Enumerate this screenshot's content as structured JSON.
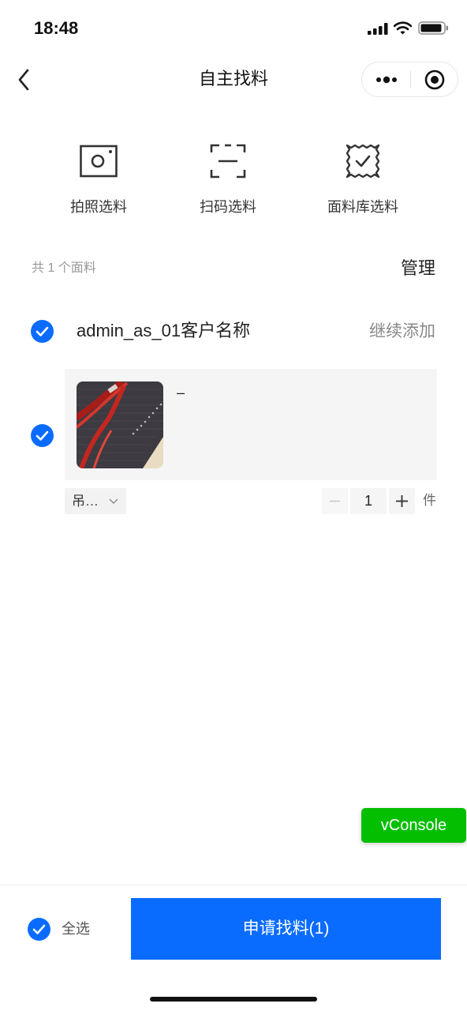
{
  "status_bar": {
    "time": "18:48",
    "icons": [
      "cellular-signal-icon",
      "wifi-icon",
      "battery-icon"
    ]
  },
  "nav": {
    "title": "自主找料",
    "back_icon": "chevron-left-icon",
    "more_icon": "more-dots-icon",
    "target_icon": "record-circle-icon"
  },
  "options": [
    {
      "label": "拍照选料",
      "icon": "camera-icon"
    },
    {
      "label": "扫码选料",
      "icon": "scan-icon"
    },
    {
      "label": "面料库选料",
      "icon": "fabric-library-icon"
    }
  ],
  "summary": {
    "count_text": "共 1 个面料",
    "manage_label": "管理"
  },
  "group": {
    "checked": true,
    "customer_name": "admin_as_01客户名称",
    "add_more_label": "继续添加"
  },
  "items": [
    {
      "checked": true,
      "name": "–",
      "spec_label": "吊…",
      "quantity": "1",
      "unit": "件"
    }
  ],
  "vconsole": {
    "label": "vConsole"
  },
  "footer": {
    "select_all_checked": true,
    "select_all_label": "全选",
    "submit_label": "申请找料(1)"
  },
  "colors": {
    "primary": "#0A6CFF",
    "vconsole": "#04BE02",
    "text": "#222222",
    "muted": "#999999"
  }
}
